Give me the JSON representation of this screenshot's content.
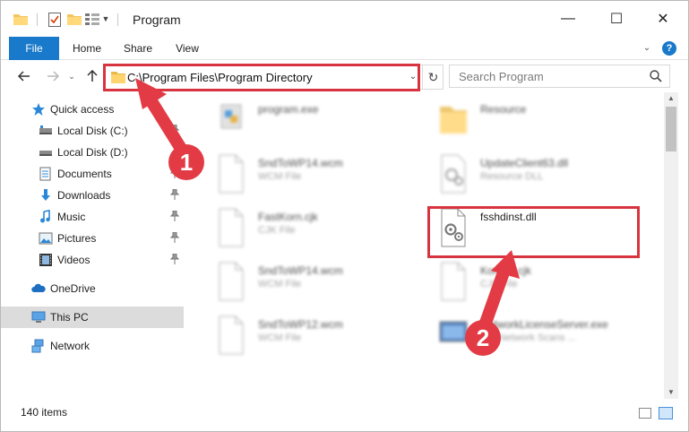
{
  "window": {
    "title": "Program",
    "controls": {
      "minimize": "—",
      "maximize": "☐",
      "close": "✕"
    }
  },
  "ribbon": {
    "tabs": [
      "File",
      "Home",
      "Share",
      "View"
    ],
    "help": "?"
  },
  "address_bar": {
    "path": "C:\\Program Files\\Program Directory"
  },
  "search": {
    "placeholder": "Search Program"
  },
  "sidebar": {
    "items": [
      {
        "label": "Quick access",
        "icon": "star-icon",
        "pinned": false
      },
      {
        "label": "Local Disk (C:)",
        "icon": "drive-icon",
        "pinned": true
      },
      {
        "label": "Local Disk (D:)",
        "icon": "drive-icon",
        "pinned": false
      },
      {
        "label": "Documents",
        "icon": "documents-icon",
        "pinned": true
      },
      {
        "label": "Downloads",
        "icon": "downloads-icon",
        "pinned": true
      },
      {
        "label": "Music",
        "icon": "music-icon",
        "pinned": true
      },
      {
        "label": "Pictures",
        "icon": "pictures-icon",
        "pinned": true
      },
      {
        "label": "Videos",
        "icon": "videos-icon",
        "pinned": true
      },
      {
        "label": "OneDrive",
        "icon": "cloud-icon",
        "pinned": false
      },
      {
        "label": "This PC",
        "icon": "computer-icon",
        "pinned": false,
        "selected": true
      },
      {
        "label": "Network",
        "icon": "network-icon",
        "pinned": false
      }
    ]
  },
  "files": [
    {
      "name": "program.exe",
      "type": "",
      "icon": "exe-icon",
      "blurred": true
    },
    {
      "name": "Resource",
      "type": "",
      "icon": "folder-icon",
      "blurred": true
    },
    {
      "name": "SndToWP14.wcm",
      "type": "WCM File",
      "icon": "file-icon",
      "blurred": true
    },
    {
      "name": "UpdateClient63.dll",
      "type": "Resource DLL",
      "icon": "dll-icon",
      "blurred": true
    },
    {
      "name": "FastKorn.cjk",
      "type": "CJK File",
      "icon": "file-icon",
      "blurred": true
    },
    {
      "name": "fsshdinst.dll",
      "type": "",
      "icon": "dll-icon",
      "blurred": false
    },
    {
      "name": "SndToWP14.wcm",
      "type": "WCM File",
      "icon": "file-icon",
      "blurred": true
    },
    {
      "name": "Korean.cjk",
      "type": "CJK File",
      "icon": "file-icon",
      "blurred": true
    },
    {
      "name": "SndToWP12.wcm",
      "type": "WCM File",
      "icon": "file-icon",
      "blurred": true
    },
    {
      "name": "NetworkLicenseServer.exe",
      "type": "WP Network Scans ...",
      "icon": "app-icon",
      "blurred": true
    }
  ],
  "status": {
    "item_count": "140 items"
  },
  "annotations": {
    "step1": "1",
    "step2": "2",
    "highlight_color": "#d8343f",
    "badge_color": "#e33b45"
  },
  "colors": {
    "accent": "#1979ca"
  }
}
